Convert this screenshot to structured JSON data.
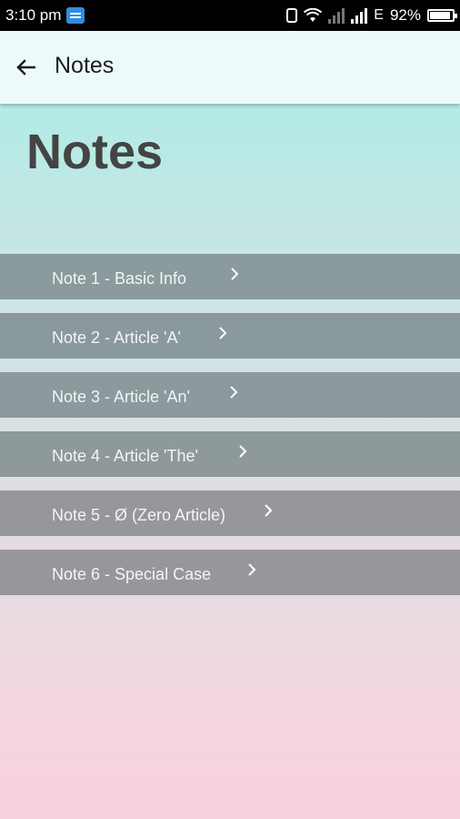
{
  "status_bar": {
    "time": "3:10 pm",
    "network_type": "E",
    "battery_percent": "92%",
    "battery_level": 0.92,
    "icons": [
      "message-icon",
      "vibrate-icon",
      "wifi-icon",
      "signal-icon",
      "battery-icon"
    ]
  },
  "app_bar": {
    "title": "Notes",
    "back_icon": "arrow-left-icon"
  },
  "page": {
    "heading": "Notes"
  },
  "notes": [
    {
      "label": "Note 1 - Basic Info",
      "color": "#8b9b9d"
    },
    {
      "label": "Note 2 - Article 'A'",
      "color": "#8a999e"
    },
    {
      "label": "Note 3 - Article 'An'",
      "color": "#8c999d"
    },
    {
      "label": "Note 4 - Article 'The'",
      "color": "#8e9999"
    },
    {
      "label": "Note 5 - Ø (Zero Article)",
      "color": "#95979b"
    },
    {
      "label": "Note 6 - Special Case",
      "color": "#97979b"
    }
  ],
  "colors": {
    "accent": "#2f8de4",
    "status_bar": "#000000",
    "app_bar": "#edfafa"
  }
}
